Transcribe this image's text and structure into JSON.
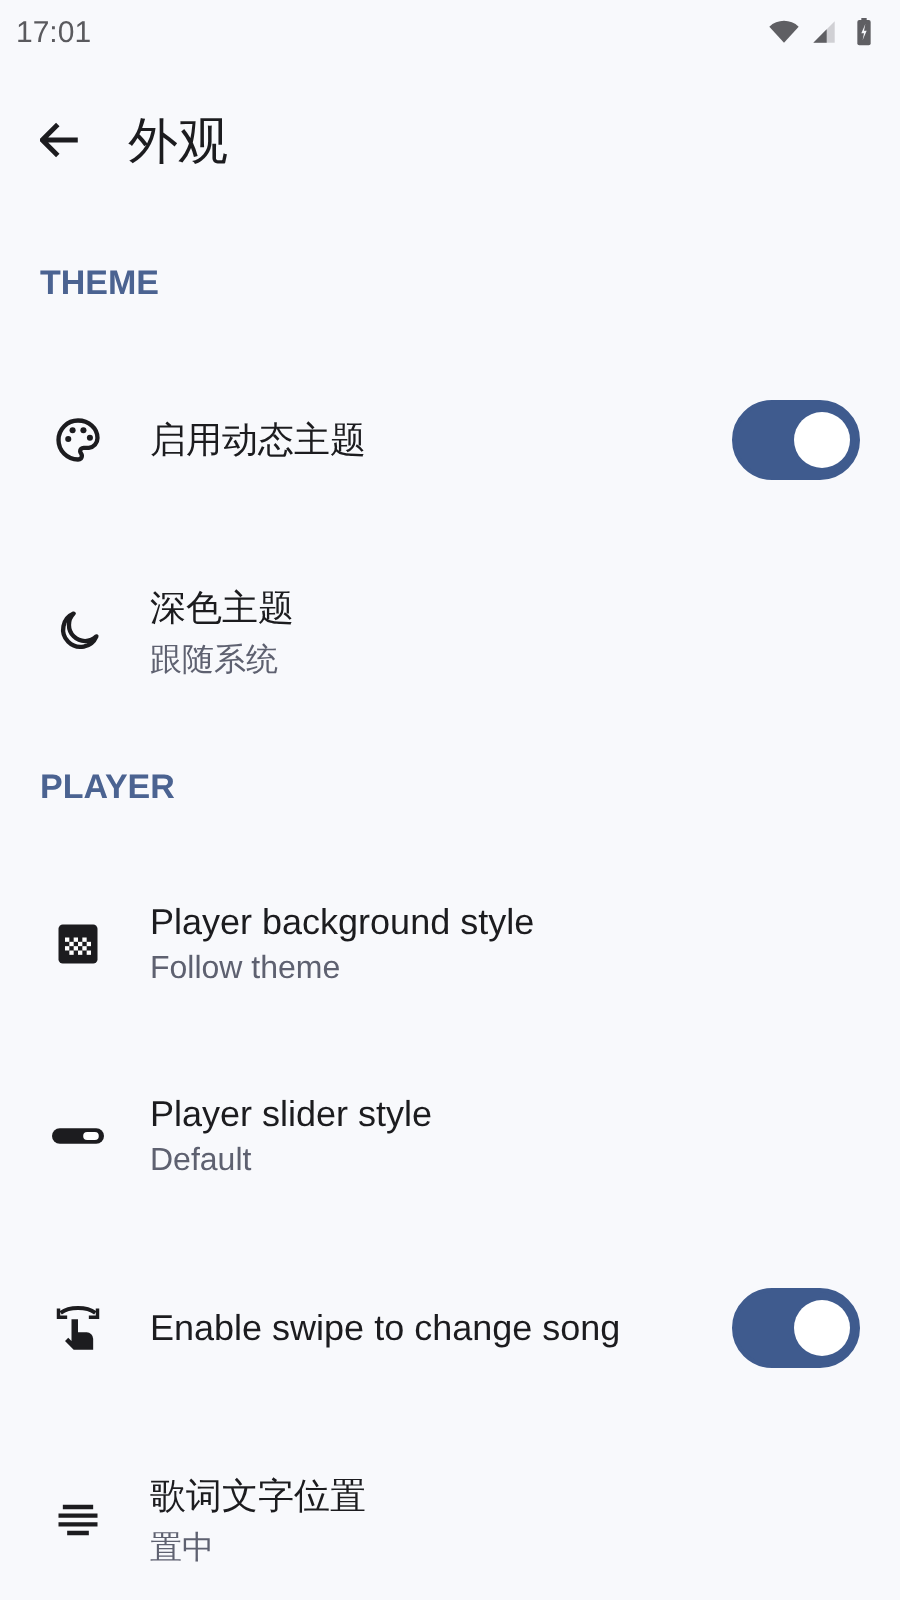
{
  "status_bar": {
    "time": "17:01"
  },
  "top_bar": {
    "title": "外观"
  },
  "sections": [
    {
      "title": "THEME",
      "items": [
        {
          "kind": "toggle",
          "title": "启用动态主题",
          "on": true
        },
        {
          "kind": "choice",
          "title": "深色主题",
          "value": "跟随系统"
        }
      ]
    },
    {
      "title": "PLAYER",
      "items": [
        {
          "kind": "choice",
          "title": "Player background style",
          "value": "Follow theme"
        },
        {
          "kind": "choice",
          "title": "Player slider style",
          "value": "Default"
        },
        {
          "kind": "toggle",
          "title": "Enable swipe to change song",
          "on": true
        },
        {
          "kind": "choice",
          "title": "歌词文字位置",
          "value": "置中"
        }
      ]
    }
  ]
}
